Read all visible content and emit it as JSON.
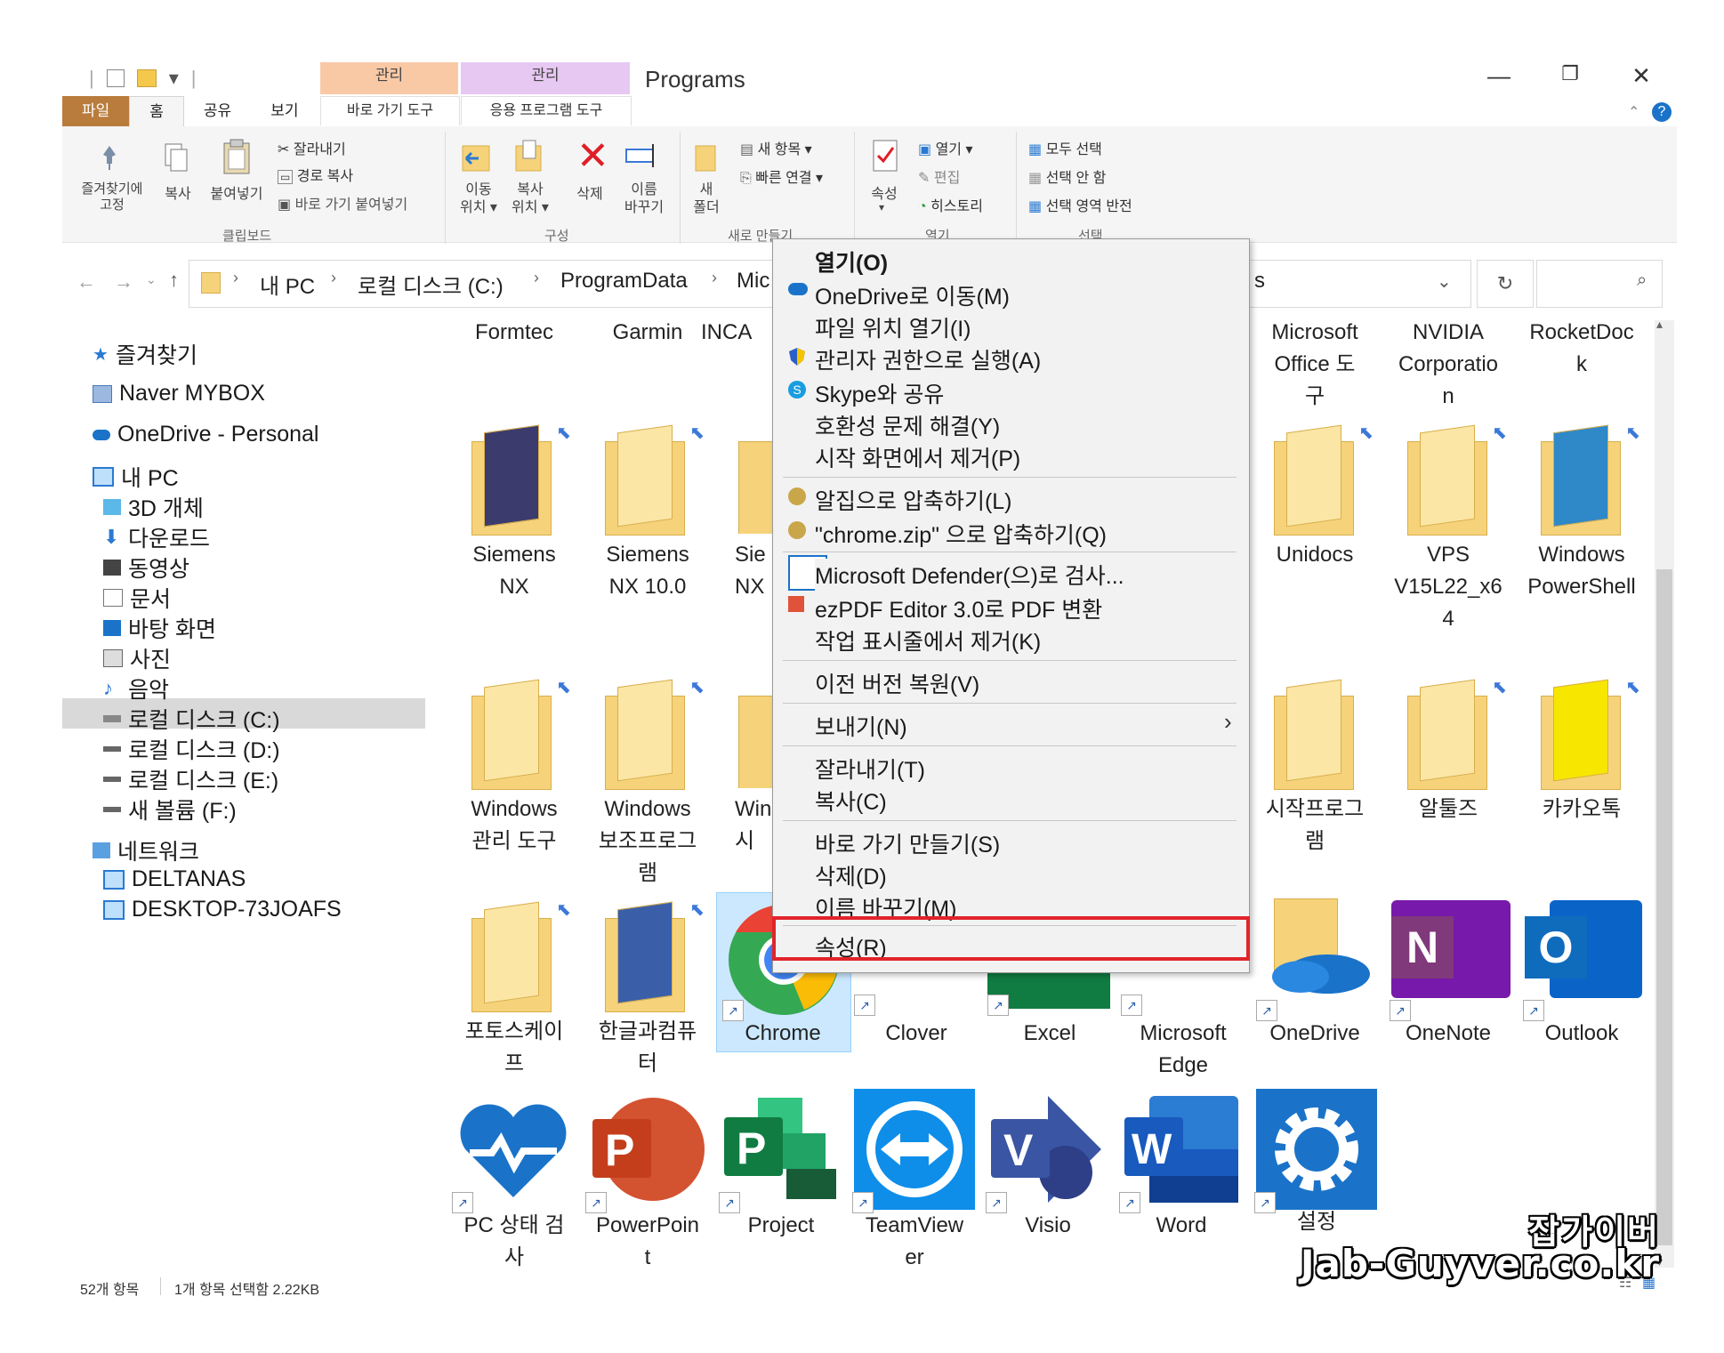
{
  "window": {
    "title": "Programs",
    "context_tab_1": "관리",
    "context_tab_2": "관리",
    "minimize": "—",
    "restore": "❐",
    "close": "✕",
    "help": "?"
  },
  "ribbon_tabs": {
    "file": "파일",
    "home": "홈",
    "share": "공유",
    "view": "보기",
    "shortcut_tools": "바로 가기 도구",
    "app_tools": "응용 프로그램 도구"
  },
  "ribbon": {
    "pin_quick": "즐겨찾기에\n고정",
    "copy": "복사",
    "paste": "붙여넣기",
    "cut": "잘라내기",
    "copy_path": "경로 복사",
    "paste_shortcut": "바로 가기 붙여넣기",
    "clipboard_group": "클립보드",
    "move_to": "이동\n위치 ▾",
    "copy_to": "복사\n위치 ▾",
    "delete": "삭제",
    "rename": "이름\n바꾸기",
    "organize_group": "구성",
    "new_folder": "새\n폴더",
    "new_item": "새 항목 ▾",
    "easy_access": "빠른 연결 ▾",
    "new_group": "새로 만들기",
    "properties": "속성",
    "open": "열기 ▾",
    "edit": "편집",
    "history": "히스토리",
    "open_group": "열기",
    "select_all": "모두 선택",
    "select_none": "선택 안 함",
    "invert_selection": "선택 영역 반전",
    "select_group": "선택"
  },
  "address": {
    "crumbs": [
      "내 PC",
      "로컬 디스크 (C:)",
      "ProgramData",
      "Mic"
    ],
    "tail": "s",
    "sep": "›"
  },
  "nav": {
    "quick_access": "즐겨찾기",
    "mybox": "Naver MYBOX",
    "onedrive": "OneDrive - Personal",
    "this_pc": "내 PC",
    "objects3d": "3D 개체",
    "downloads": "다운로드",
    "videos": "동영상",
    "documents": "문서",
    "desktop": "바탕 화면",
    "pictures": "사진",
    "music": "음악",
    "local_c": "로컬 디스크 (C:)",
    "local_d": "로컬 디스크 (D:)",
    "local_e": "로컬 디스크 (E:)",
    "vol_f": "새 볼륨 (F:)",
    "network": "네트워크",
    "deltanas": "DELTANAS",
    "desktop_pc": "DESKTOP-73JOAFS"
  },
  "items": {
    "formtec": "Formtec",
    "garmin": "Garmin",
    "inca": "INCA",
    "ms_office_tools": "Microsoft\nOffice 도\n구",
    "nvidia": "NVIDIA\nCorporatio\nn",
    "rocketdock": "RocketDoc\nk",
    "siemens_nx": "Siemens\nNX",
    "siemens_nx10": "Siemens\nNX 10.0",
    "sie_nx": "Sie\nNX",
    "unidocs": "Unidocs",
    "vps": "VPS\nV15L22_x6\n4",
    "powershell": "Windows\nPowerShell",
    "win_admin": "Windows\n관리 도구",
    "win_accessories": "Windows\n보조프로그\n램",
    "win_short": "Win\n시",
    "startup": "시작프로그\n램",
    "altools": "알툴즈",
    "kakaotalk": "카카오톡",
    "fotoskape": "포토스케이\n프",
    "hancom": "한글과컴퓨\n터",
    "chrome": "Chrome",
    "clover": "Clover",
    "excel": "Excel",
    "edge": "Microsoft\nEdge",
    "onedrive": "OneDrive",
    "onenote": "OneNote",
    "outlook": "Outlook",
    "pc_health": "PC 상태 검\n사",
    "powerpoint": "PowerPoin\nt",
    "project": "Project",
    "teamviewer": "TeamView\ner",
    "visio": "Visio",
    "word": "Word",
    "settings": "설정"
  },
  "context_menu": {
    "open": "열기(O)",
    "move_onedrive": "OneDrive로 이동(M)",
    "open_location": "파일 위치 열기(I)",
    "run_admin": "관리자 권한으로 실행(A)",
    "skype_share": "Skype와 공유",
    "troubleshoot": "호환성 문제 해결(Y)",
    "unpin_start": "시작 화면에서 제거(P)",
    "alzip_compress": "알집으로 압축하기(L)",
    "alzip_chrome": "\"chrome.zip\" 으로 압축하기(Q)",
    "defender": "Microsoft Defender(으)로 검사...",
    "ezpdf": "ezPDF Editor 3.0로 PDF 변환",
    "unpin_taskbar": "작업 표시줄에서 제거(K)",
    "restore_prev": "이전 버전 복원(V)",
    "send_to": "보내기(N)",
    "cut": "잘라내기(T)",
    "copy": "복사(C)",
    "create_shortcut": "바로 가기 만들기(S)",
    "delete": "삭제(D)",
    "rename": "이름 바꾸기(M)",
    "properties": "속성(R)",
    "submenu_arrow": "›"
  },
  "status": {
    "count": "52개 항목",
    "selected": "1개 항목 선택함 2.22KB"
  },
  "watermark": {
    "line1": "잡가이버",
    "line2": "Jab-Guyver.co.kr"
  },
  "colors": {
    "file_tab": "#b97c3c",
    "ctx_shortcut_tab": "#f9c9a6",
    "ctx_app_tab": "#e6c8f2",
    "highlight_box": "#e0242b",
    "selection": "#cce8ff"
  }
}
